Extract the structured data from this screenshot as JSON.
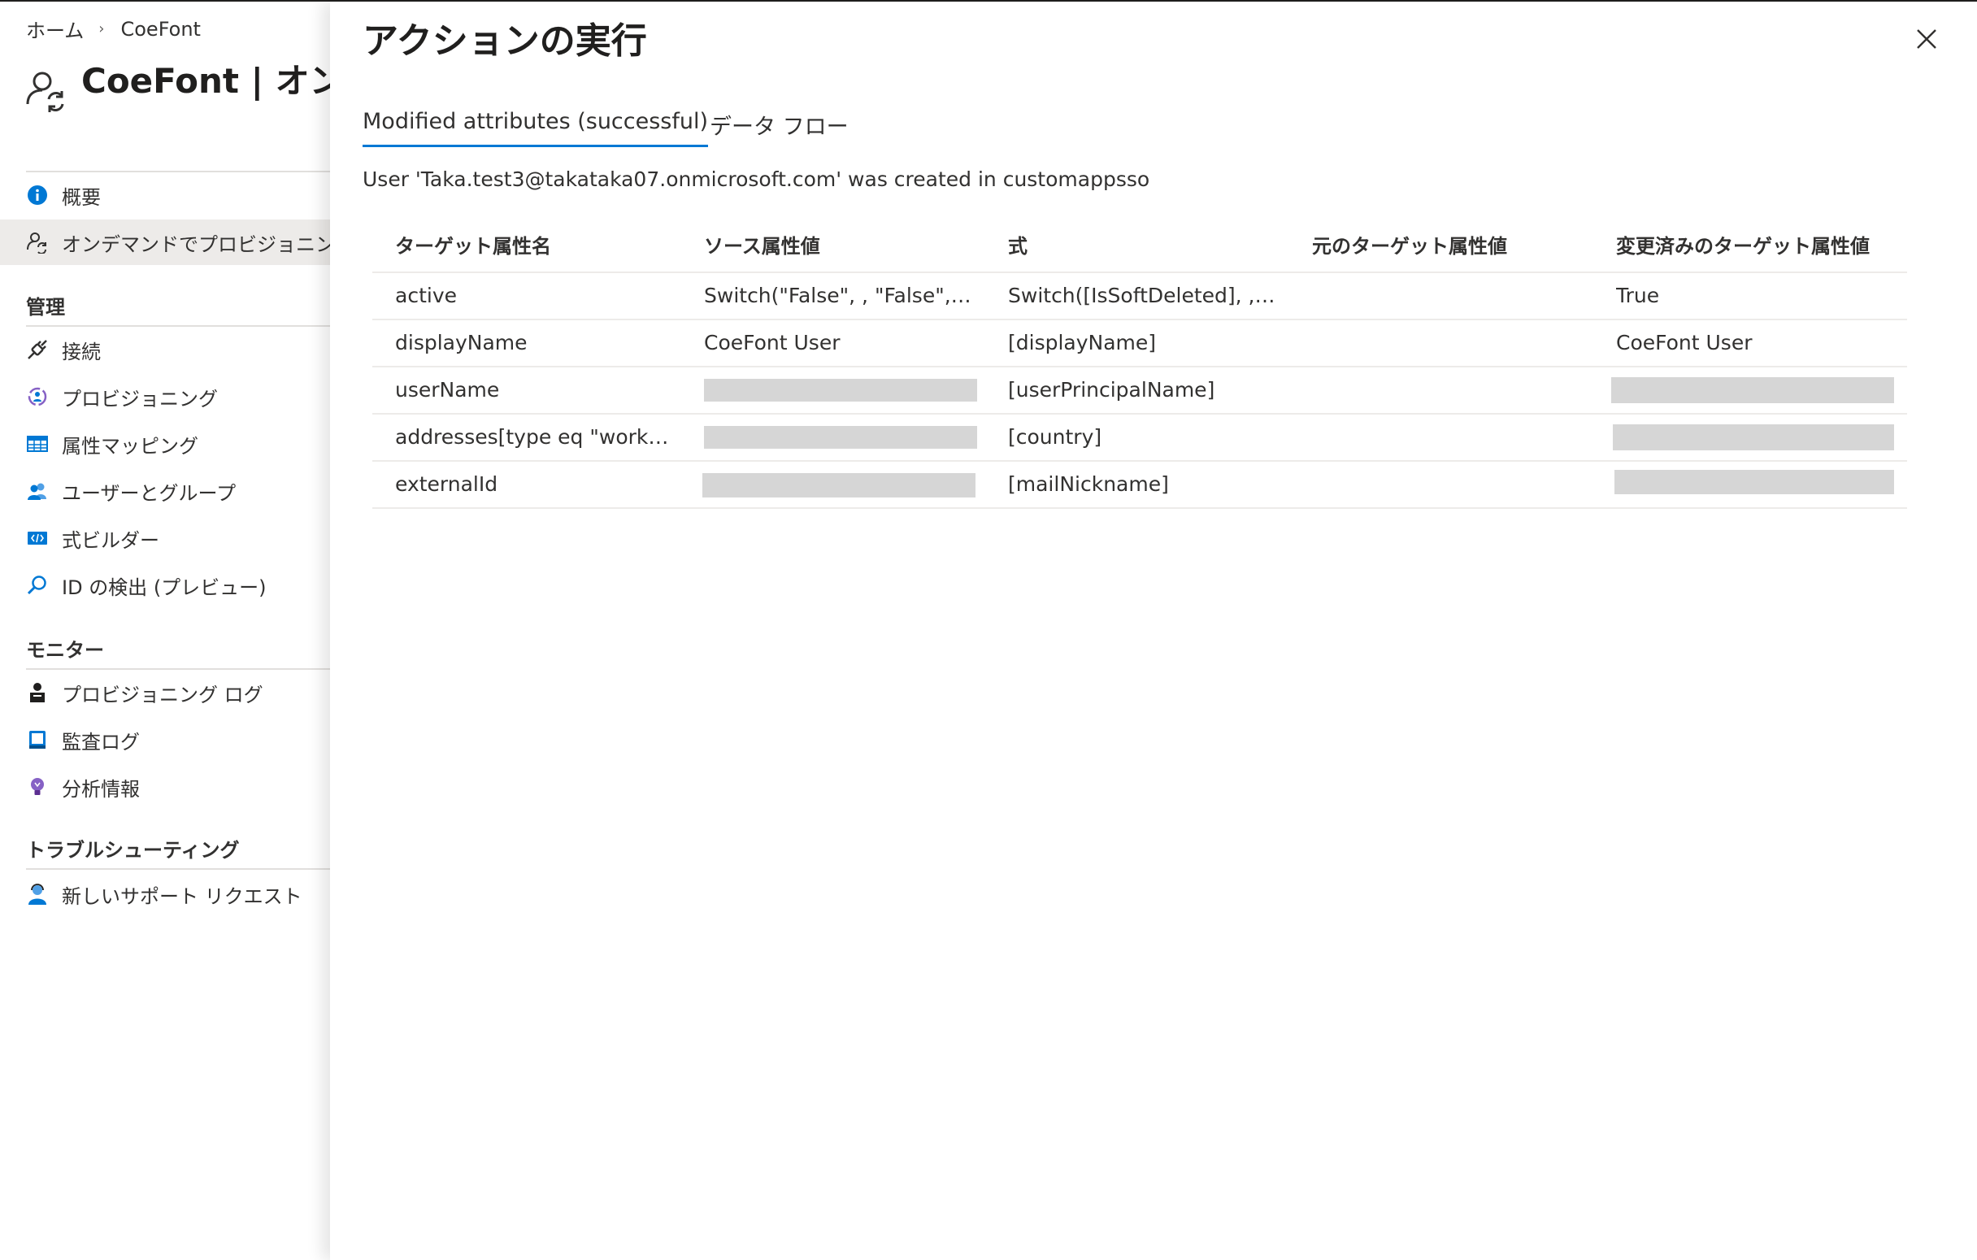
{
  "breadcrumb": {
    "home": "ホーム",
    "current": "CoeFont"
  },
  "blade": {
    "title": "CoeFont | オンデ"
  },
  "nav": {
    "overview": "概要",
    "on_demand": "オンデマンドでプロビジョニング",
    "group_manage": "管理",
    "connect": "接続",
    "provisioning": "プロビジョニング",
    "attribute_mapping": "属性マッピング",
    "users_groups": "ユーザーとグループ",
    "expression_builder": "式ビルダー",
    "id_discovery": "ID の検出 (プレビュー)",
    "group_monitor": "モニター",
    "provisioning_logs": "プロビジョニング ログ",
    "audit_logs": "監査ログ",
    "insights": "分析情報",
    "group_troubleshoot": "トラブルシューティング",
    "new_support_request": "新しいサポート リクエスト"
  },
  "panel": {
    "title": "アクションの実行",
    "tabs": [
      {
        "label": "Modified attributes (successful)",
        "active": true
      },
      {
        "label": "データ フロー",
        "active": false
      }
    ],
    "message": "User 'Taka.test3@takataka07.onmicrosoft.com' was created in customappsso"
  },
  "table": {
    "columns": [
      "ターゲット属性名",
      "ソース属性値",
      "式",
      "元のターゲット属性値",
      "変更済みのターゲット属性値"
    ],
    "rows": [
      {
        "target": "active",
        "source": "Switch(\"False\", , \"False\", \"…",
        "expression": "Switch([IsSoftDeleted], , \"…",
        "original": "",
        "modified": "True",
        "source_redacted": false,
        "modified_redacted": false
      },
      {
        "target": "displayName",
        "source": "CoeFont User",
        "expression": "[displayName]",
        "original": "",
        "modified": "CoeFont User",
        "source_redacted": false,
        "modified_redacted": false
      },
      {
        "target": "userName",
        "source": "",
        "expression": "[userPrincipalName]",
        "original": "",
        "modified": "",
        "source_redacted": true,
        "modified_redacted": true
      },
      {
        "target": "addresses[type eq \"work\"]…",
        "source": "",
        "expression": "[country]",
        "original": "",
        "modified": "",
        "source_redacted": true,
        "modified_redacted": true
      },
      {
        "target": "externalId",
        "source": "",
        "expression": "[mailNickname]",
        "original": "",
        "modified": "",
        "source_redacted": true,
        "modified_redacted": true
      }
    ]
  },
  "colors": {
    "accent": "#0078d4",
    "selected_nav": "#edebe9",
    "redaction": "#d6d6d6"
  },
  "icons": {
    "blade": "user-sync-icon",
    "close": "close-icon"
  }
}
